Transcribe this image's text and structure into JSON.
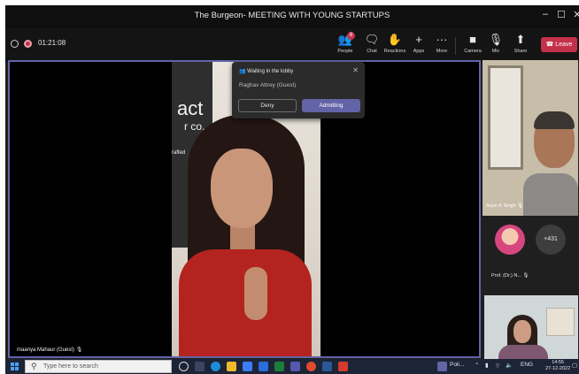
{
  "window": {
    "title": "The Burgeon- MEETING WITH YOUNG STARTUPS",
    "controls": {
      "minimize": "–",
      "maximize": "☐",
      "close": "✕"
    }
  },
  "toolbar": {
    "timer": "01:21:08",
    "people_label": "People",
    "people_badge": "8",
    "chat_label": "Chat",
    "reactions_label": "Reactions",
    "apps_label": "Apps",
    "more_label": "More",
    "camera_label": "Camera",
    "mic_label": "Mic",
    "share_label": "Share",
    "leave_label": "Leave"
  },
  "main_video": {
    "banner_line1": "act",
    "banner_line2": "r co.",
    "banner_line3": "rafted",
    "participant_name": "maanya Mahaur (Guest)"
  },
  "lobby_popup": {
    "header": "Waiting in the lobby",
    "guest": "Raghav Attrey (Guest)",
    "deny_label": "Deny",
    "admit_label": "Admitting"
  },
  "side_panel": {
    "tile1_name": "Arjun K Singh",
    "avatar_label": "Prof. (Dr.) N...",
    "more_count": "+431"
  },
  "taskbar": {
    "search_placeholder": "Type here to search",
    "pinned_app_label": "Poli...",
    "tray_text": "ENG",
    "time": "14:55",
    "date": "27-12-2022"
  },
  "colors": {
    "accent": "#6264a7",
    "leave": "#c4314b",
    "background": "#1f1f1f",
    "taskbar": "#1c2436"
  }
}
